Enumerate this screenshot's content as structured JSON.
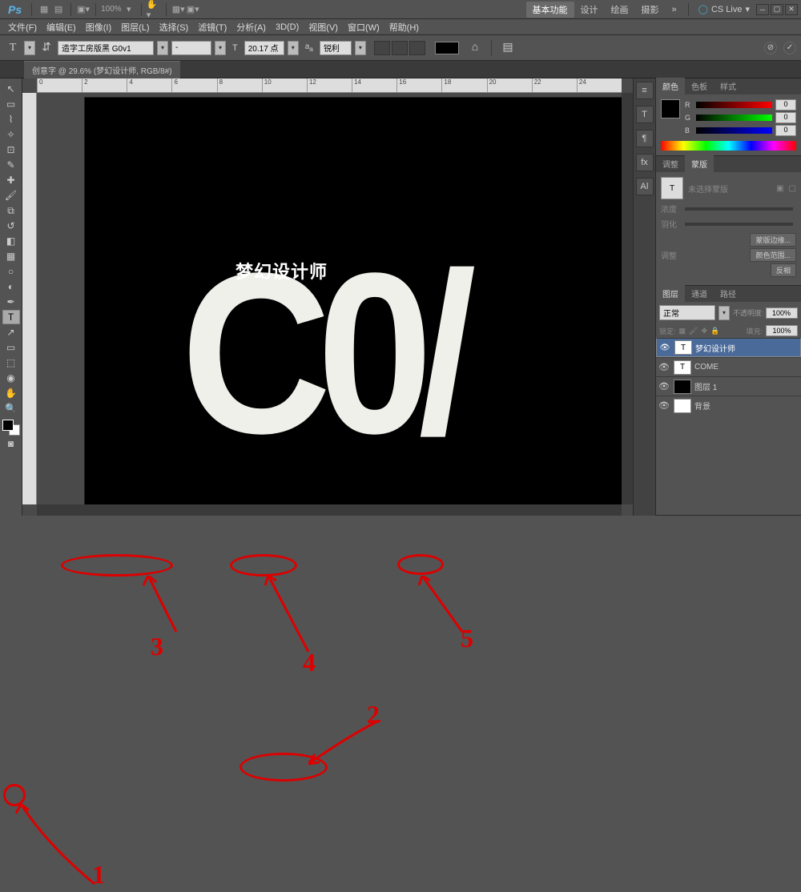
{
  "app": {
    "logo": "Ps",
    "zoom_dd": "100%"
  },
  "workspace": {
    "active": "基本功能",
    "items": [
      "设计",
      "绘画",
      "摄影"
    ]
  },
  "cslive": "CS Live",
  "menus": [
    "文件(F)",
    "编辑(E)",
    "图像(I)",
    "图层(L)",
    "选择(S)",
    "滤镜(T)",
    "分析(A)",
    "3D(D)",
    "视图(V)",
    "窗口(W)",
    "帮助(H)"
  ],
  "options": {
    "font": "造字工房版黑 G0v1",
    "style": "-",
    "size": "20.17 点",
    "aa": "锐利"
  },
  "doc_tab": "创意字 @ 29.6% (梦幻设计师, RGB/8#)",
  "canvas_overlay": "梦幻设计师",
  "come": "C0/",
  "ruler_marks": [
    "0",
    "2",
    "4",
    "6",
    "8",
    "10",
    "12",
    "14",
    "16",
    "18",
    "20",
    "22",
    "24"
  ],
  "color_panel": {
    "tabs": [
      "颜色",
      "色板",
      "样式"
    ],
    "r": "0",
    "g": "0",
    "b": "0"
  },
  "mask_panel": {
    "tabs": [
      "调整",
      "蒙版"
    ],
    "none": "未选择蒙版",
    "density": "浓度",
    "feather": "羽化",
    "adjust": "调整",
    "btn_edge": "蒙版边缘...",
    "btn_range": "颜色范围...",
    "btn_inv": "反相"
  },
  "layers_panel": {
    "tabs": [
      "图层",
      "通道",
      "路径"
    ],
    "blend": "正常",
    "opacity_lbl": "不透明度:",
    "opacity": "100%",
    "fill_lbl": "填充:",
    "fill": "100%",
    "lock_lbl": "锁定:",
    "layers": [
      {
        "thumb": "T",
        "name": "梦幻设计师",
        "sel": true
      },
      {
        "thumb": "T",
        "name": "COME"
      },
      {
        "thumb": "black",
        "name": "图层 1"
      },
      {
        "thumb": "white",
        "name": "背景"
      }
    ]
  },
  "annotations": {
    "n1": "1",
    "n2": "2",
    "n3": "3",
    "n4": "4",
    "n5": "5"
  }
}
